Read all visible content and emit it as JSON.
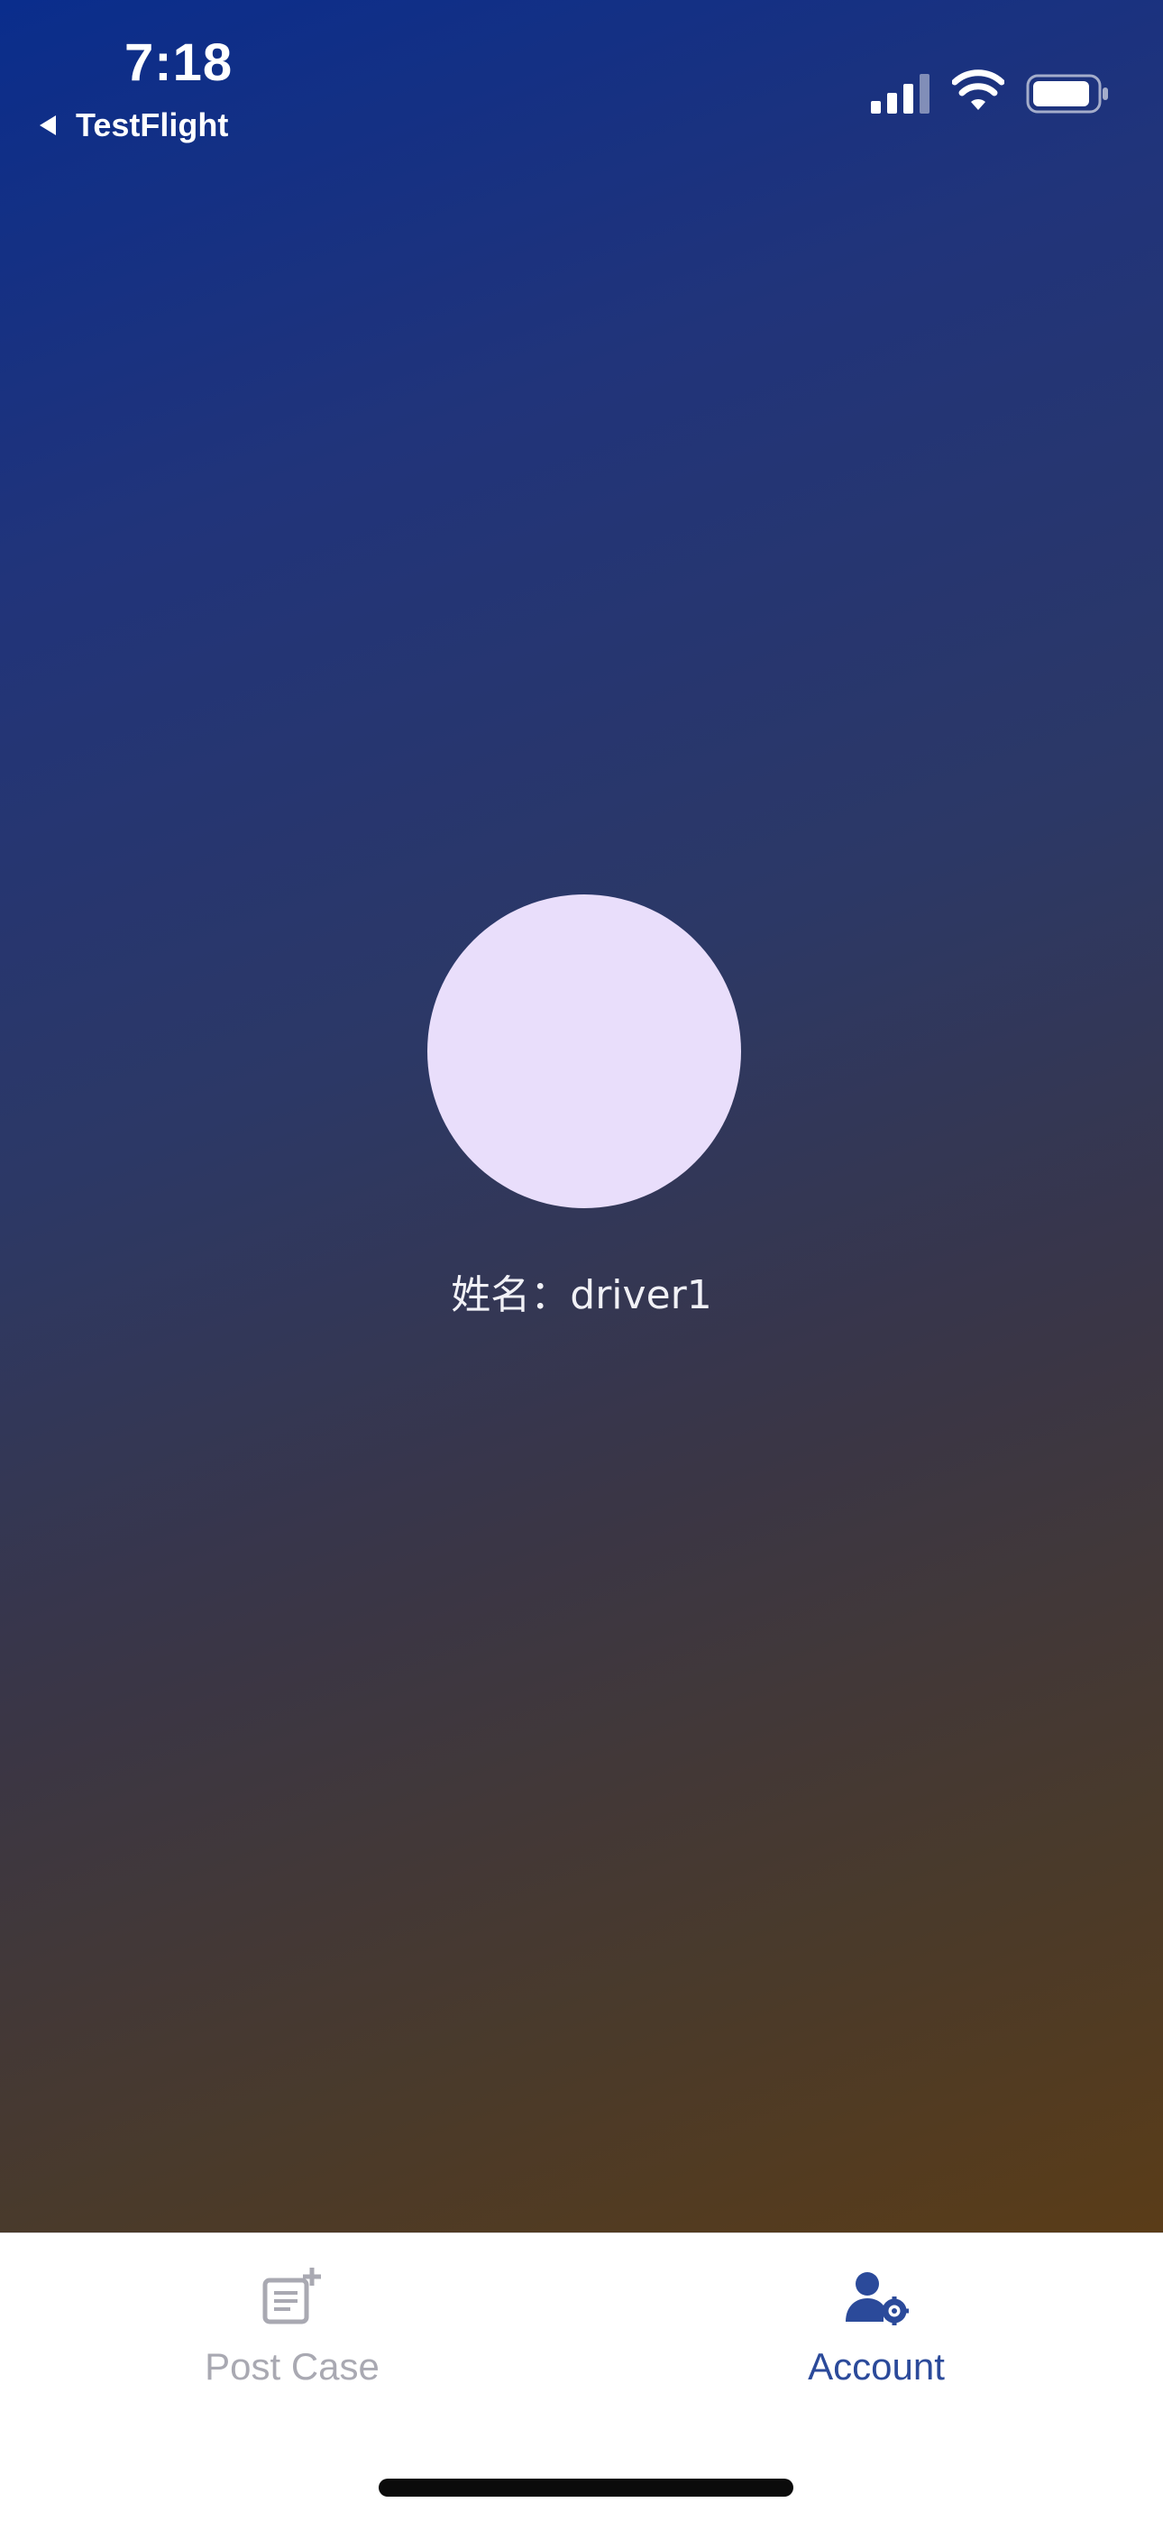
{
  "status_bar": {
    "time": "7:18",
    "back_app_label": "TestFlight"
  },
  "profile": {
    "name_label": "姓名：driver1"
  },
  "tabbar": {
    "tabs": [
      {
        "label": "Post Case",
        "icon": "post-case-icon",
        "selected": false
      },
      {
        "label": "Account",
        "icon": "account-settings-icon",
        "selected": true
      }
    ]
  },
  "colors": {
    "gradient_start": "#0a2d8c",
    "gradient_end": "#5a3c18",
    "avatar": "#e9defb",
    "tab_active": "#2b4a9a",
    "tab_inactive": "#a9a9b2"
  }
}
